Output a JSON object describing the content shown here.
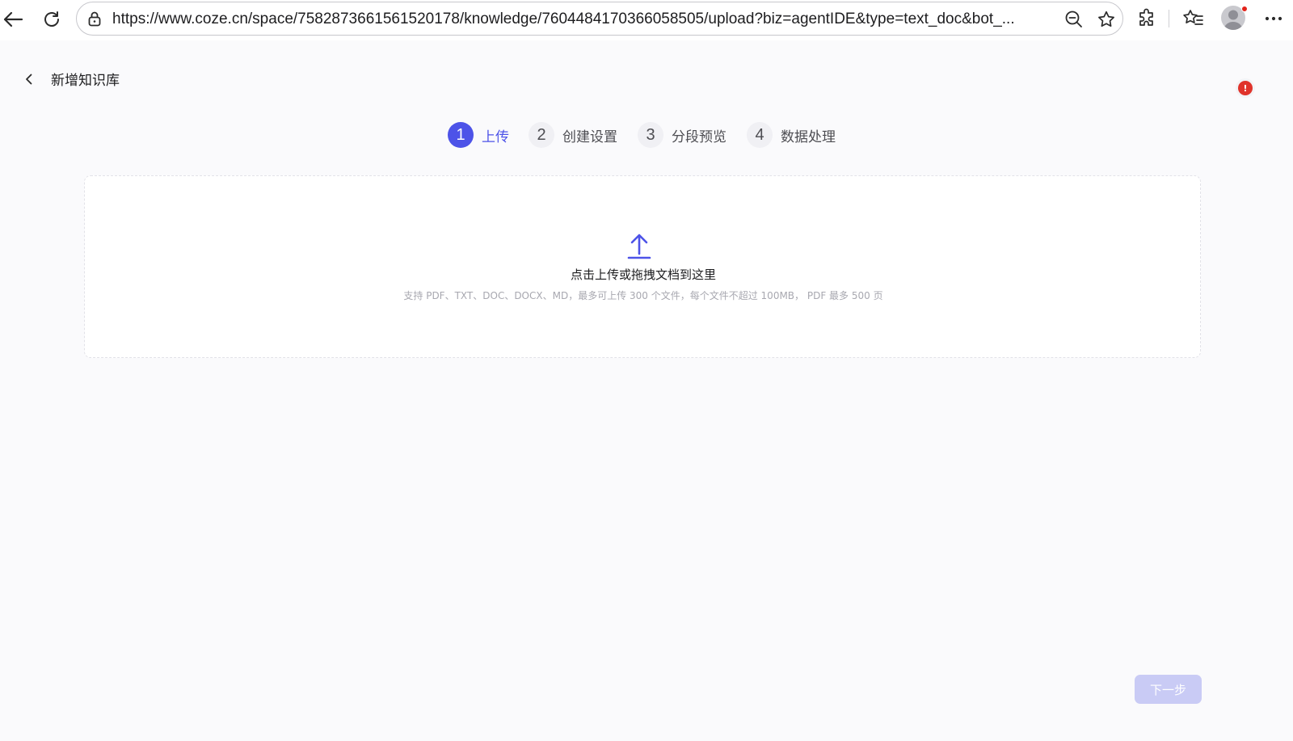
{
  "browser": {
    "url": "https://www.coze.cn/space/7582873661561520178/knowledge/7604484170366058505/upload?biz=agentIDE&type=text_doc&bot_..."
  },
  "page": {
    "title": "新增知识库"
  },
  "steps": [
    {
      "number": "1",
      "label": "上传",
      "active": true
    },
    {
      "number": "2",
      "label": "创建设置",
      "active": false
    },
    {
      "number": "3",
      "label": "分段预览",
      "active": false
    },
    {
      "number": "4",
      "label": "数据处理",
      "active": false
    }
  ],
  "upload": {
    "main_text": "点击上传或拖拽文档到这里",
    "hint_text": "支持 PDF、TXT、DOC、DOCX、MD，最多可上传 300 个文件，每个文件不超过 100MB， PDF 最多 500 页"
  },
  "footer": {
    "next_label": "下一步"
  },
  "notification": {
    "badge": "!"
  },
  "colors": {
    "accent": "#4d53e8",
    "accent_disabled": "#c9cbf5",
    "alert": "#e0332b"
  },
  "icons": [
    "back-arrow-icon",
    "reload-icon",
    "lock-icon",
    "zoom-out-icon",
    "star-icon",
    "extensions-icon",
    "favorites-icon",
    "avatar-icon",
    "more-icon",
    "chevron-left-icon",
    "upload-icon",
    "alert-icon"
  ]
}
